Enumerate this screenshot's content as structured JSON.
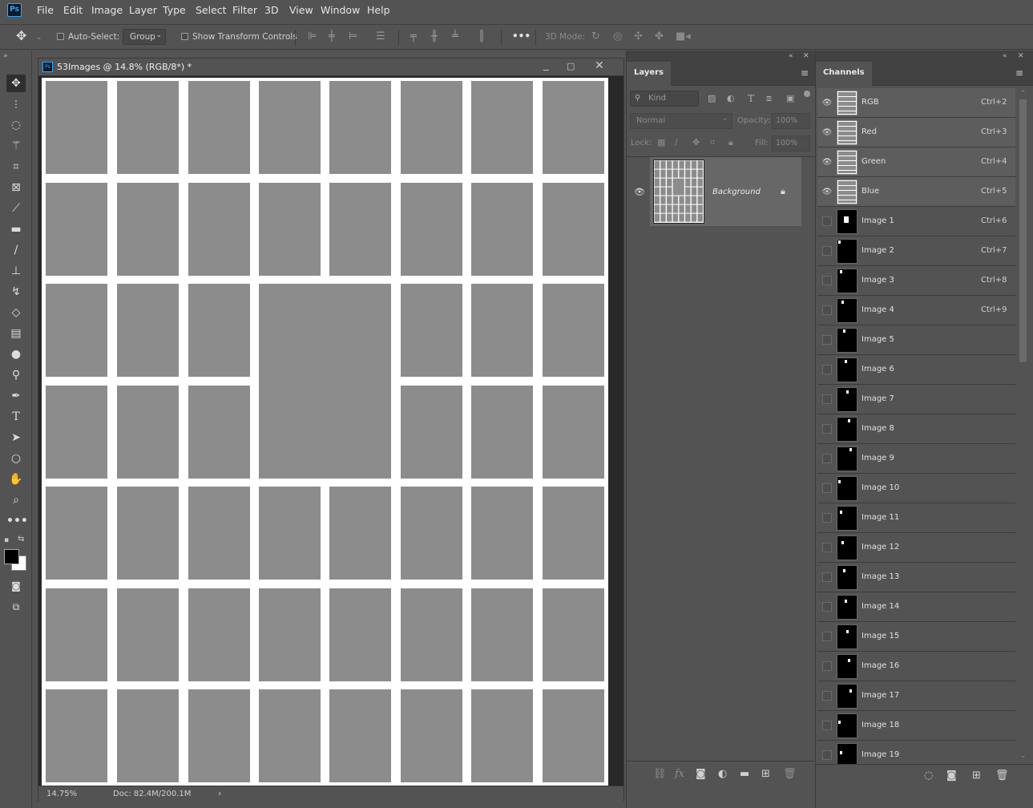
{
  "menu": {
    "logo": "Ps",
    "items": [
      "File",
      "Edit",
      "Image",
      "Layer",
      "Type",
      "Select",
      "Filter",
      "3D",
      "View",
      "Window",
      "Help"
    ]
  },
  "options": {
    "auto_select_label": "Auto-Select:",
    "auto_select_value": "Group",
    "transform_label": "Show Transform Controls",
    "mode_3d_label": "3D Mode:",
    "more_label": "•••"
  },
  "document": {
    "tab_title": "53Images  @ 14.8% (RGB/8*) *",
    "zoom": "14.75%",
    "doc_info": "Doc: 82.4M/200.1M"
  },
  "layers_panel": {
    "tab": "Layers",
    "filter_placeholder": "Kind",
    "blend_mode": "Normal",
    "opacity_label": "Opacity:",
    "opacity_value": "100%",
    "lock_label": "Lock:",
    "fill_label": "Fill:",
    "fill_value": "100%",
    "layers": [
      {
        "name": "Background",
        "locked": true,
        "visible": true
      }
    ]
  },
  "channels_panel": {
    "tab": "Channels",
    "channels": [
      {
        "name": "RGB",
        "key": "Ctrl+2",
        "visible": true
      },
      {
        "name": "Red",
        "key": "Ctrl+3",
        "visible": true
      },
      {
        "name": "Green",
        "key": "Ctrl+4",
        "visible": true
      },
      {
        "name": "Blue",
        "key": "Ctrl+5",
        "visible": true
      },
      {
        "name": "Image 1",
        "key": "Ctrl+6",
        "visible": false
      },
      {
        "name": "Image 2",
        "key": "Ctrl+7",
        "visible": false
      },
      {
        "name": "Image 3",
        "key": "Ctrl+8",
        "visible": false
      },
      {
        "name": "Image 4",
        "key": "Ctrl+9",
        "visible": false
      },
      {
        "name": "Image 5",
        "key": "",
        "visible": false
      },
      {
        "name": "Image 6",
        "key": "",
        "visible": false
      },
      {
        "name": "Image 7",
        "key": "",
        "visible": false
      },
      {
        "name": "Image 8",
        "key": "",
        "visible": false
      },
      {
        "name": "Image 9",
        "key": "",
        "visible": false
      },
      {
        "name": "Image 10",
        "key": "",
        "visible": false
      },
      {
        "name": "Image 11",
        "key": "",
        "visible": false
      },
      {
        "name": "Image 12",
        "key": "",
        "visible": false
      },
      {
        "name": "Image 13",
        "key": "",
        "visible": false
      },
      {
        "name": "Image 14",
        "key": "",
        "visible": false
      },
      {
        "name": "Image 15",
        "key": "",
        "visible": false
      },
      {
        "name": "Image 16",
        "key": "",
        "visible": false
      },
      {
        "name": "Image 17",
        "key": "",
        "visible": false
      },
      {
        "name": "Image 18",
        "key": "",
        "visible": false
      },
      {
        "name": "Image 19",
        "key": "",
        "visible": false
      }
    ]
  },
  "colors": {
    "ui_bg": "#535353",
    "canvas_placeholder": "#8c8c8c",
    "accent": "#31a8ff"
  }
}
